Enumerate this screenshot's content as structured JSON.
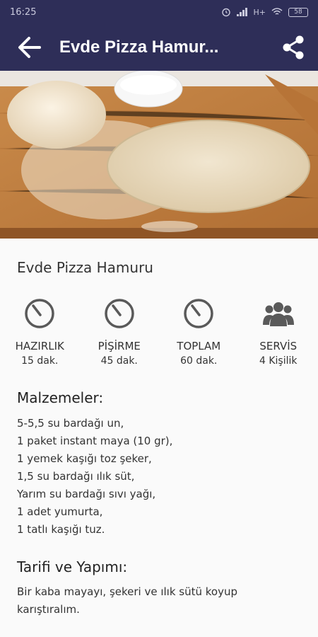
{
  "status_bar": {
    "time": "16:25",
    "network": "H+",
    "battery": "58"
  },
  "toolbar": {
    "title": "Evde Pizza Hamur..."
  },
  "recipe": {
    "title": "Evde Pizza Hamuru"
  },
  "stats": [
    {
      "icon": "timer-icon",
      "label": "HAZIRLIK",
      "value": "15 dak."
    },
    {
      "icon": "timer-icon",
      "label": "PİŞİRME",
      "value": "45 dak."
    },
    {
      "icon": "timer-icon",
      "label": "TOPLAM",
      "value": "60 dak."
    },
    {
      "icon": "people-icon",
      "label": "SERVİS",
      "value": "4 Kişilik"
    }
  ],
  "ingredients": {
    "heading": "Malzemeler:",
    "items": [
      "5-5,5 su bardağı un,",
      "1 paket instant maya (10 gr),",
      "1 yemek kaşığı toz şeker,",
      "1,5 su bardağı ılık süt,",
      "Yarım su bardağı sıvı yağı,",
      "1 adet yumurta,",
      "1 tatlı kaşığı tuz."
    ]
  },
  "instructions": {
    "heading": "Tarifi ve Yapımı:",
    "text": "Bir kaba mayayı, şekeri ve ılık sütü koyup karıştıralım."
  },
  "colors": {
    "toolbar": "#2e2e58",
    "icon": "#5a5a5a",
    "background": "#fafafa"
  }
}
